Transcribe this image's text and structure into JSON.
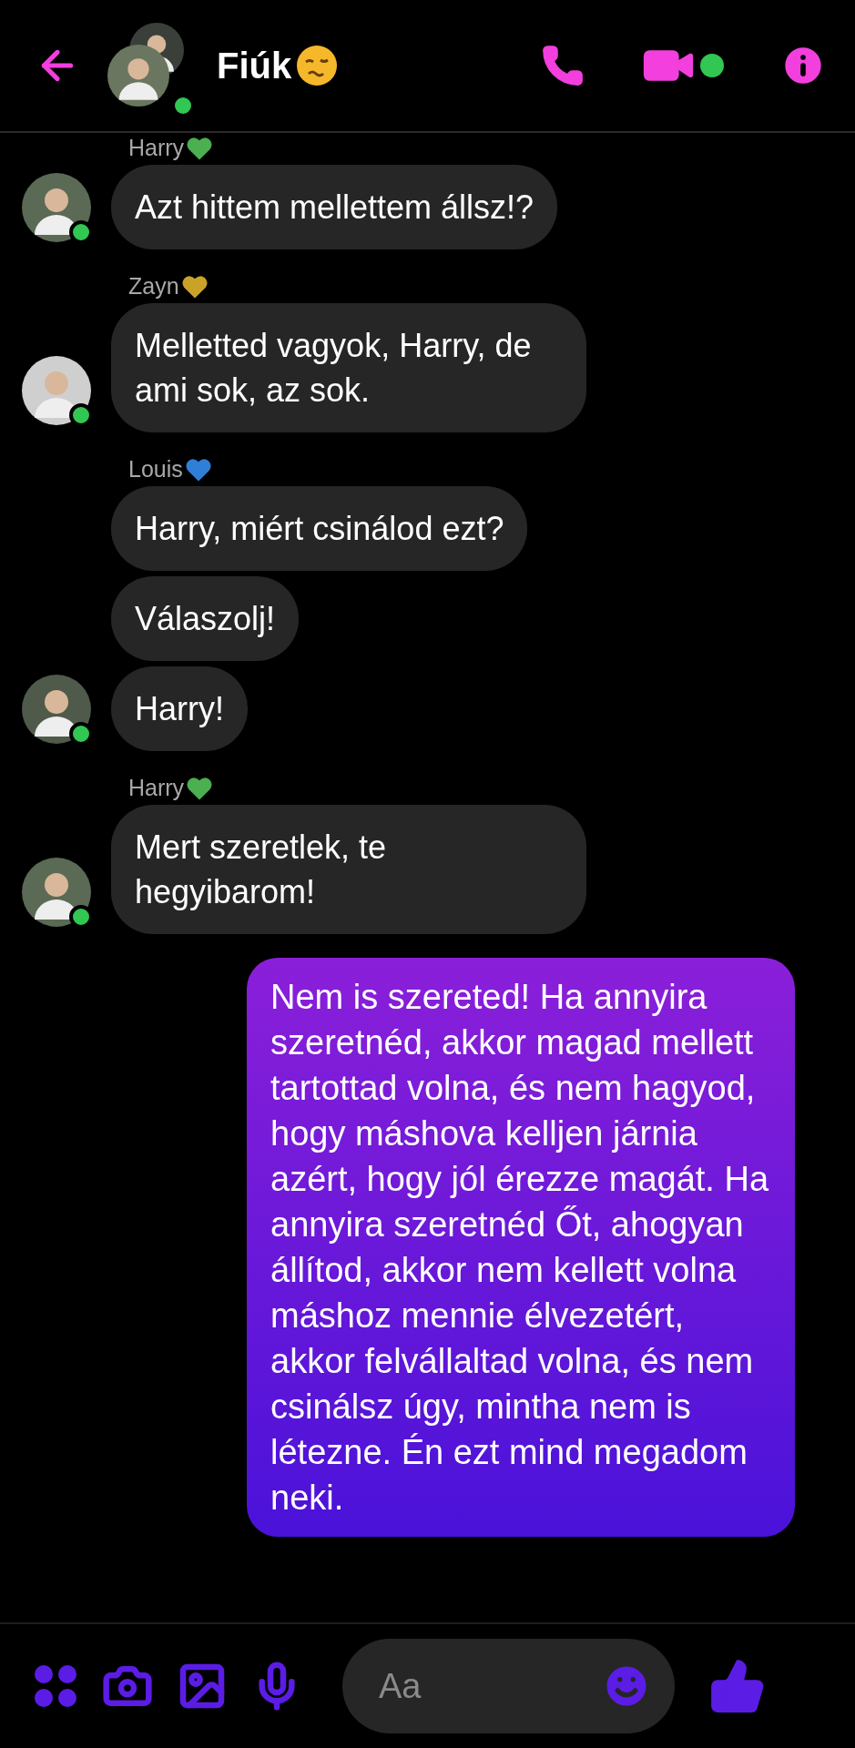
{
  "header": {
    "title": "Fiúk",
    "online": true,
    "video_active": true
  },
  "groups": [
    {
      "kind": "incoming",
      "sender": "Harry",
      "color": "#4caf50",
      "online": true,
      "bubbles": [
        "Azt hittem mellettem állsz!?"
      ]
    },
    {
      "kind": "incoming",
      "sender": "Zayn",
      "color": "#c9a227",
      "online": true,
      "bubbles": [
        "Melletted vagyok, Harry, de ami sok, az sok."
      ]
    },
    {
      "kind": "incoming",
      "sender": "Louis",
      "color": "#2f7fd8",
      "online": true,
      "bubbles": [
        "Harry, miért csinálod ezt?",
        "Válaszolj!",
        "Harry!"
      ]
    },
    {
      "kind": "incoming",
      "sender": "Harry",
      "color": "#4caf50",
      "online": true,
      "bubbles": [
        "Mert szeretlek, te hegyibarom!"
      ]
    },
    {
      "kind": "outgoing",
      "bubbles": [
        "Nem is szereted! Ha annyira szeretnéd, akkor magad mellett tartottad volna, és nem hagyod, hogy máshova kelljen járnia azért, hogy jól érezze magát. Ha annyira szeretnéd Őt, ahogyan állítod, akkor nem kellett volna máshoz mennie élvezetért, akkor felvállaltad volna, és nem csinálsz úgy, mintha nem is létezne. Én ezt mind megadom neki."
      ]
    }
  ],
  "composer": {
    "placeholder": "Aa"
  }
}
